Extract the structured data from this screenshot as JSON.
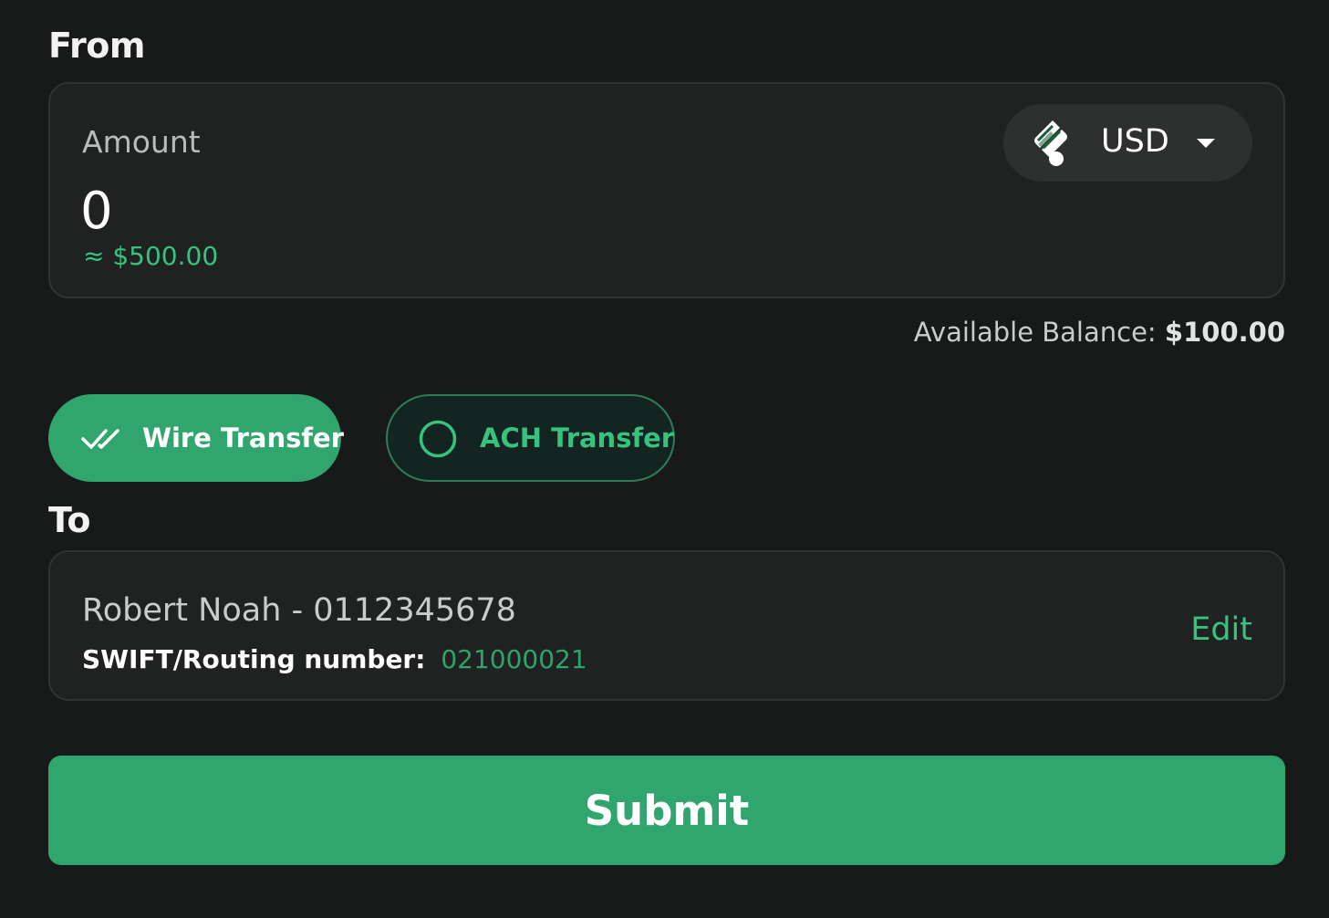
{
  "from": {
    "section_label": "From",
    "amount_label": "Amount",
    "amount_value": "0",
    "amount_approx": "≈ $500.00",
    "currency": {
      "code": "USD",
      "icon": "currency-logo-icon",
      "expand_icon": "chevron-down-icon"
    },
    "balance_label": "Available Balance:",
    "balance_amount": "$100.00"
  },
  "transfer_types": {
    "wire": {
      "label": "Wire Transfer",
      "selected": true,
      "icon": "double-check-icon"
    },
    "ach": {
      "label": "ACH Transfer",
      "selected": false,
      "icon": "radio-circle-icon"
    }
  },
  "to": {
    "section_label": "To",
    "recipient": "Robert Noah - 0112345678",
    "routing_label": "SWIFT/Routing number:",
    "routing_value": "021000021",
    "edit_label": "Edit"
  },
  "submit_label": "Submit",
  "colors": {
    "background": "#181919",
    "card": "#202121",
    "accent": "#31a56e",
    "accent_text": "#37c27f"
  }
}
